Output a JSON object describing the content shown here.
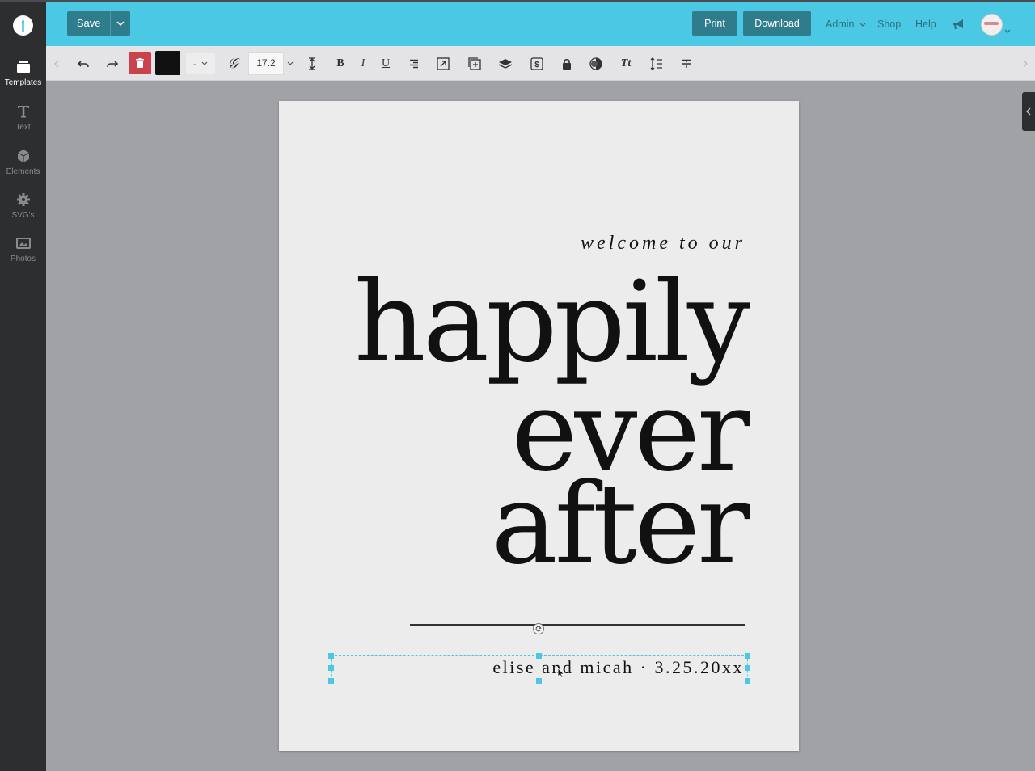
{
  "sidebar": {
    "items": [
      {
        "label": "Templates",
        "icon": "templates-icon"
      },
      {
        "label": "Text",
        "icon": "text-icon"
      },
      {
        "label": "Elements",
        "icon": "cube-icon"
      },
      {
        "label": "SVG's",
        "icon": "gear-icon"
      },
      {
        "label": "Photos",
        "icon": "photos-icon"
      }
    ]
  },
  "header": {
    "save_label": "Save",
    "print_label": "Print",
    "download_label": "Download",
    "admin_label": "Admin",
    "shop_label": "Shop",
    "help_label": "Help"
  },
  "toolbar": {
    "font_value": "-",
    "font_size": "17.2",
    "bold_label": "B",
    "italic_label": "I",
    "underline_label": "U",
    "text_style_label": "Tt"
  },
  "canvas": {
    "welcome_text": "welcome to our",
    "line1": "happily",
    "line2": "ever",
    "line3": "after",
    "subtitle": "elise and micah · 3.25.20xx"
  },
  "colors": {
    "topbar": "#4bc8e3",
    "button": "#2f7c8d",
    "delete": "#c9424c",
    "text_color_swatch": "#111111",
    "sidebar": "#2d2e30"
  }
}
